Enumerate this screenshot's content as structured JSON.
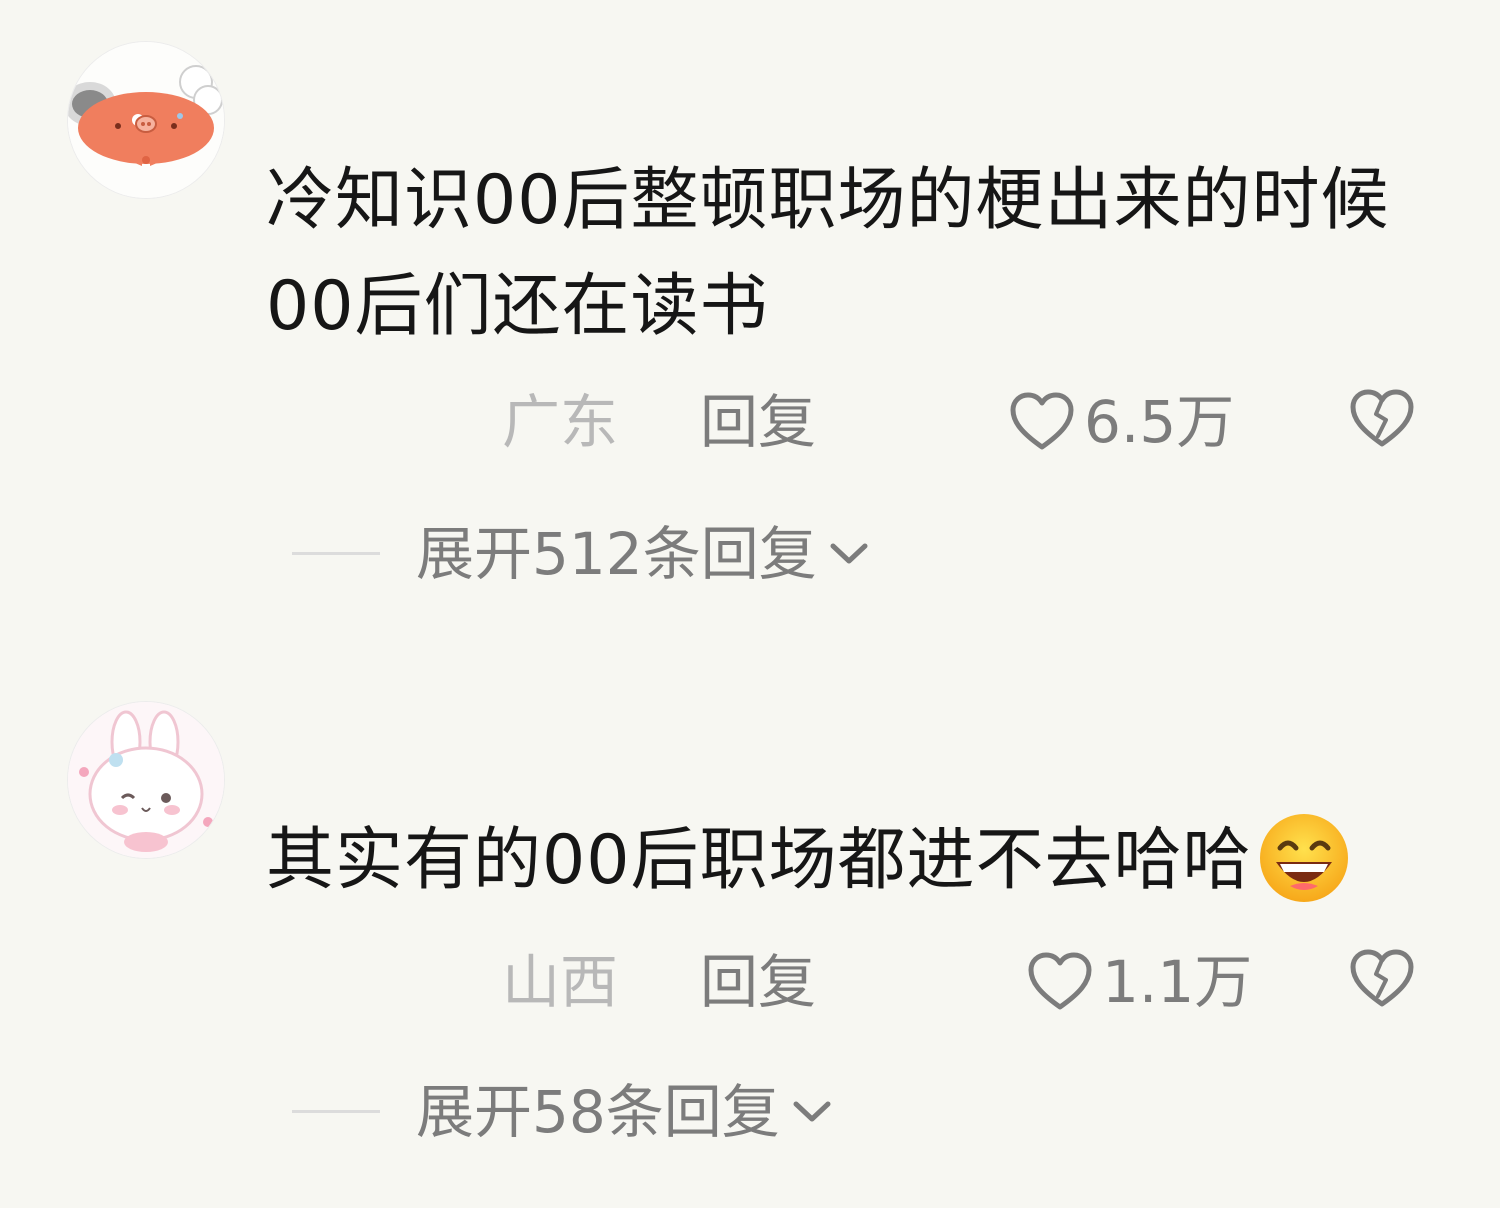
{
  "comments": [
    {
      "avatar_icon": "crab-cartoon-avatar",
      "text": "冷知识00后整顿职场的梗出来的时候00后们还在读书",
      "location": "广东",
      "reply_label": "回复",
      "like_count": "6.5万",
      "expand_label": "展开512条回复"
    },
    {
      "avatar_icon": "bunny-cartoon-avatar",
      "text": "其实有的00后职场都进不去哈哈",
      "emoji_icon": "grinning-face-emoji",
      "location": "山西",
      "reply_label": "回复",
      "like_count": "1.1万",
      "expand_label": "展开58条回复"
    }
  ],
  "colors": {
    "background": "#f7f7f2",
    "primary_text": "#161616",
    "secondary_text": "#7c7c7c",
    "location_text": "#b8b8b8",
    "avatar_crab": "#f07e5e"
  }
}
